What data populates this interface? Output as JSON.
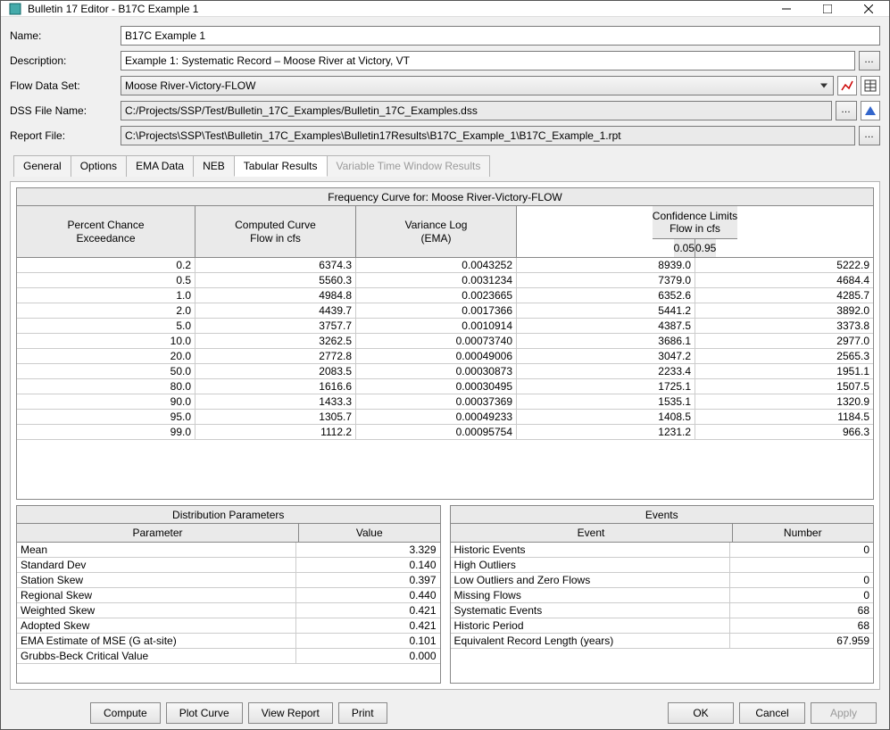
{
  "window": {
    "title": "Bulletin 17 Editor - B17C Example 1"
  },
  "form": {
    "name_label": "Name:",
    "name_value": "B17C Example 1",
    "desc_label": "Description:",
    "desc_value": "Example 1: Systematic Record – Moose River at Victory, VT",
    "flowds_label": "Flow Data Set:",
    "flowds_value": "Moose River-Victory-FLOW",
    "dss_label": "DSS File Name:",
    "dss_value": "C:/Projects/SSP/Test/Bulletin_17C_Examples/Bulletin_17C_Examples.dss",
    "report_label": "Report File:",
    "report_value": "C:\\Projects\\SSP\\Test\\Bulletin_17C_Examples\\Bulletin17Results\\B17C_Example_1\\B17C_Example_1.rpt"
  },
  "tabs": {
    "general": "General",
    "options": "Options",
    "ema": "EMA Data",
    "neb": "NEB",
    "tabular": "Tabular Results",
    "vtw": "Variable Time Window Results"
  },
  "freq": {
    "title": "Frequency Curve for: Moose River-Victory-FLOW",
    "h_pct": "Percent Chance\nExceedance",
    "h_curve": "Computed Curve\nFlow in cfs",
    "h_var": "Variance Log\n(EMA)",
    "h_conf": "Confidence Limits\nFlow in cfs",
    "h_05": "0.05",
    "h_95": "0.95",
    "rows": [
      {
        "p": "0.2",
        "c": "6374.3",
        "v": "0.0043252",
        "lo": "8939.0",
        "hi": "5222.9"
      },
      {
        "p": "0.5",
        "c": "5560.3",
        "v": "0.0031234",
        "lo": "7379.0",
        "hi": "4684.4"
      },
      {
        "p": "1.0",
        "c": "4984.8",
        "v": "0.0023665",
        "lo": "6352.6",
        "hi": "4285.7"
      },
      {
        "p": "2.0",
        "c": "4439.7",
        "v": "0.0017366",
        "lo": "5441.2",
        "hi": "3892.0"
      },
      {
        "p": "5.0",
        "c": "3757.7",
        "v": "0.0010914",
        "lo": "4387.5",
        "hi": "3373.8"
      },
      {
        "p": "10.0",
        "c": "3262.5",
        "v": "0.00073740",
        "lo": "3686.1",
        "hi": "2977.0"
      },
      {
        "p": "20.0",
        "c": "2772.8",
        "v": "0.00049006",
        "lo": "3047.2",
        "hi": "2565.3"
      },
      {
        "p": "50.0",
        "c": "2083.5",
        "v": "0.00030873",
        "lo": "2233.4",
        "hi": "1951.1"
      },
      {
        "p": "80.0",
        "c": "1616.6",
        "v": "0.00030495",
        "lo": "1725.1",
        "hi": "1507.5"
      },
      {
        "p": "90.0",
        "c": "1433.3",
        "v": "0.00037369",
        "lo": "1535.1",
        "hi": "1320.9"
      },
      {
        "p": "95.0",
        "c": "1305.7",
        "v": "0.00049233",
        "lo": "1408.5",
        "hi": "1184.5"
      },
      {
        "p": "99.0",
        "c": "1112.2",
        "v": "0.00095754",
        "lo": "1231.2",
        "hi": "966.3"
      }
    ]
  },
  "dist": {
    "title": "Distribution Parameters",
    "h_param": "Parameter",
    "h_val": "Value",
    "rows": [
      {
        "p": "Mean",
        "v": "3.329"
      },
      {
        "p": "Standard Dev",
        "v": "0.140"
      },
      {
        "p": "Station Skew",
        "v": "0.397"
      },
      {
        "p": "Regional Skew",
        "v": "0.440"
      },
      {
        "p": "Weighted Skew",
        "v": "0.421"
      },
      {
        "p": "Adopted Skew",
        "v": "0.421"
      },
      {
        "p": "EMA Estimate of MSE (G at-site)",
        "v": "0.101"
      },
      {
        "p": "Grubbs-Beck Critical Value",
        "v": "0.000"
      }
    ]
  },
  "events": {
    "title": "Events",
    "h_event": "Event",
    "h_num": "Number",
    "rows": [
      {
        "e": "Historic Events",
        "n": "0"
      },
      {
        "e": "High Outliers",
        "n": ""
      },
      {
        "e": "Low Outliers and Zero Flows",
        "n": "0"
      },
      {
        "e": "Missing Flows",
        "n": "0"
      },
      {
        "e": "Systematic Events",
        "n": "68"
      },
      {
        "e": "Historic Period",
        "n": "68"
      },
      {
        "e": "Equivalent Record Length (years)",
        "n": "67.959"
      }
    ]
  },
  "buttons": {
    "compute": "Compute",
    "plot": "Plot Curve",
    "view": "View Report",
    "print": "Print",
    "ok": "OK",
    "cancel": "Cancel",
    "apply": "Apply"
  }
}
